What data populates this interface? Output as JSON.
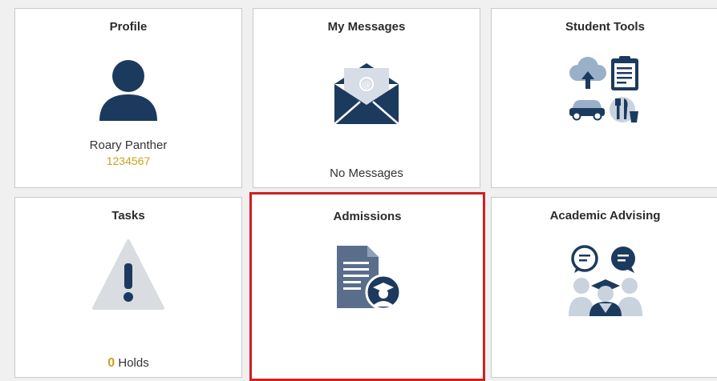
{
  "profile": {
    "title": "Profile",
    "name": "Roary Panther",
    "id": "1234567",
    "icon": "person-icon"
  },
  "messages": {
    "title": "My Messages",
    "status": "No Messages",
    "icon": "envelope-icon"
  },
  "tools": {
    "title": "Student Tools",
    "icons": [
      "cloud-upload-icon",
      "clipboard-icon",
      "car-icon",
      "dining-icon"
    ]
  },
  "tasks": {
    "title": "Tasks",
    "holds_count": "0",
    "holds_label": "Holds",
    "icon": "warning-icon"
  },
  "admissions": {
    "title": "Admissions",
    "icon": "graduation-document-icon"
  },
  "advising": {
    "title": "Academic Advising",
    "icon": "advising-icon"
  },
  "colors": {
    "navy": "#1c3a5e",
    "gold": "#c8a21e",
    "highlight": "#d21f1f",
    "warning_gray": "#d9dce0",
    "doc_gray": "#5a6e8c"
  }
}
